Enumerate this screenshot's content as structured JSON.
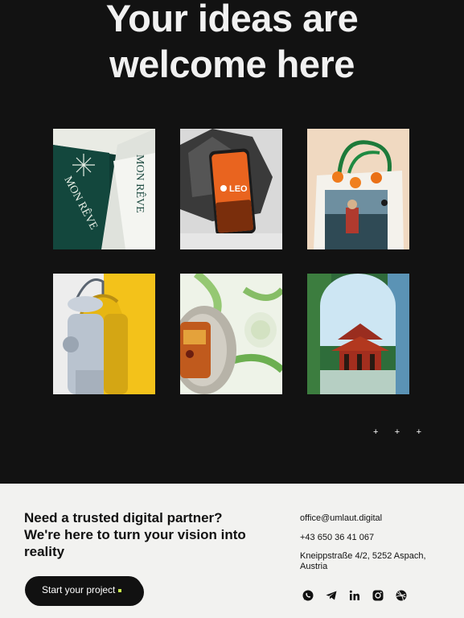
{
  "hero": {
    "headline_line1": "Your ideas are",
    "headline_line2": "welcome here"
  },
  "gallery": {
    "items": [
      {
        "name": "mon-reve-branding",
        "brand_text_1": "MON RÊVE",
        "brand_text_2": "MON RÊVE"
      },
      {
        "name": "leo-phone-mockup",
        "brand_text": "LEO"
      },
      {
        "name": "tote-bag-mockup"
      },
      {
        "name": "lantern-illustration"
      },
      {
        "name": "food-plate-photo"
      },
      {
        "name": "pagoda-collage"
      }
    ],
    "slider_dots": [
      "+",
      "+",
      "+"
    ]
  },
  "footer": {
    "tagline": "Need a trusted digital partner? We're here to turn your vision into reality",
    "cta_label": "Start your project",
    "email": "office@umlaut.digital",
    "phone": "+43 650 36 41 067",
    "address": "Kneippstraße 4/2, 5252 Aspach, Austria",
    "social_icons": [
      "whatsapp-icon",
      "telegram-icon",
      "linkedin-icon",
      "instagram-icon",
      "dribbble-icon"
    ]
  },
  "colors": {
    "background_dark": "#121212",
    "footer_bg": "#f2f2f0",
    "accent": "#c8e94a"
  }
}
